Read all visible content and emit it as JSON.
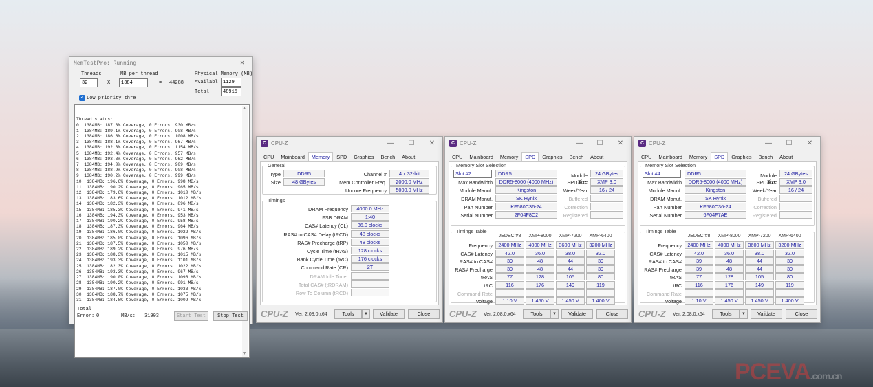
{
  "memtest": {
    "title": "MemTestPro: Running",
    "threads_label": "Threads",
    "threads": "32",
    "mb_label": "MB per thread",
    "mb": "1384",
    "x": "X",
    "eq": "=",
    "total_mb": "44288",
    "phys_label": "Physical Memory (MB)",
    "avail_label": "Availabl",
    "avail": "1129",
    "total_label": "Total",
    "total": "48915",
    "lowprio": "Low priority thre",
    "log": [
      "Thread status:",
      "0: 1384MB: 187.3% Coverage, 0 Errors. 930 MB/s",
      "1: 1384MB: 189.1% Coverage, 0 Errors. 908 MB/s",
      "2: 1384MB: 186.8% Coverage, 0 Errors. 1008 MB/s",
      "3: 1384MB: 188.1% Coverage, 0 Errors. 967 MB/s",
      "4: 1384MB: 192.3% Coverage, 0 Errors. 1154 MB/s",
      "5: 1384MB: 192.4% Coverage, 0 Errors. 957 MB/s",
      "6: 1384MB: 193.3% Coverage, 0 Errors. 962 MB/s",
      "7: 1384MB: 194.0% Coverage, 0 Errors. 909 MB/s",
      "8: 1384MB: 188.9% Coverage, 0 Errors. 908 MB/s",
      "9: 1384MB: 190.2% Coverage, 0 Errors. 999 MB/s",
      "10: 1384MB: 196.6% Coverage, 0 Errors. 998 MB/s",
      "11: 1384MB: 190.2% Coverage, 0 Errors. 965 MB/s",
      "12: 1384MB: 179.6% Coverage, 0 Errors. 1010 MB/s",
      "13: 1384MB: 183.6% Coverage, 0 Errors. 1012 MB/s",
      "14: 1384MB: 182.3% Coverage, 0 Errors. 896 MB/s",
      "15: 1384MB: 185.3% Coverage, 0 Errors. 941 MB/s",
      "16: 1384MB: 194.3% Coverage, 0 Errors. 953 MB/s",
      "17: 1384MB: 190.2% Coverage, 0 Errors. 958 MB/s",
      "18: 1384MB: 187.3% Coverage, 0 Errors. 964 MB/s",
      "19: 1384MB: 186.0% Coverage, 0 Errors. 1022 MB/s",
      "20: 1384MB: 185.0% Coverage, 0 Errors. 1096 MB/s",
      "21: 1384MB: 187.5% Coverage, 0 Errors. 1050 MB/s",
      "22: 1384MB: 189.2% Coverage, 0 Errors. 976 MB/s",
      "23: 1384MB: 188.3% Coverage, 0 Errors. 1015 MB/s",
      "24: 1384MB: 193.3% Coverage, 0 Errors. 1101 MB/s",
      "25: 1384MB: 182.3% Coverage, 0 Errors. 1022 MB/s",
      "26: 1384MB: 193.3% Coverage, 0 Errors. 967 MB/s",
      "27: 1384MB: 190.0% Coverage, 0 Errors. 1098 MB/s",
      "28: 1384MB: 190.2% Coverage, 0 Errors. 991 MB/s",
      "29: 1384MB: 187.0% Coverage, 0 Errors. 1033 MB/s",
      "30: 1384MB: 188.7% Coverage, 0 Errors. 1075 MB/s",
      "31: 1384MB: 184.8% Coverage, 0 Errors. 1009 MB/s"
    ],
    "total_label2": "Total",
    "err_label": "Error:",
    "err": "0",
    "mbs_label": "MB/s:",
    "mbs": "31903",
    "start": "Start Test",
    "stop": "Stop Test"
  },
  "cpuz_common": {
    "title": "CPU-Z",
    "tabs": [
      "CPU",
      "Mainboard",
      "Memory",
      "SPD",
      "Graphics",
      "Bench",
      "About"
    ],
    "brand": "CPU-Z",
    "version": "Ver. 2.08.0.x64",
    "tools": "Tools",
    "validate": "Validate",
    "close": "Close"
  },
  "memory": {
    "general_title": "General",
    "type_label": "Type",
    "type": "DDR5",
    "size_label": "Size",
    "size": "48 GBytes",
    "channel_label": "Channel #",
    "channel": "4 x 32-bit",
    "mcf_label": "Mem Controller Freq.",
    "mcf": "2000.0 MHz",
    "uncore_label": "Uncore Frequency",
    "uncore": "5000.0 MHz",
    "timings_title": "Timings",
    "rows": [
      {
        "label": "DRAM Frequency",
        "value": "4000.0 MHz",
        "dim": false
      },
      {
        "label": "FSB:DRAM",
        "value": "1:40",
        "dim": false
      },
      {
        "label": "CAS# Latency (CL)",
        "value": "36.0 clocks",
        "dim": false
      },
      {
        "label": "RAS# to CAS# Delay (tRCD)",
        "value": "48 clocks",
        "dim": false
      },
      {
        "label": "RAS# Precharge (tRP)",
        "value": "48 clocks",
        "dim": false
      },
      {
        "label": "Cycle Time (tRAS)",
        "value": "128 clocks",
        "dim": false
      },
      {
        "label": "Bank Cycle Time (tRC)",
        "value": "176 clocks",
        "dim": false
      },
      {
        "label": "Command Rate (CR)",
        "value": "2T",
        "dim": false
      },
      {
        "label": "DRAM Idle Timer",
        "value": "",
        "dim": true
      },
      {
        "label": "Total CAS# (tRDRAM)",
        "value": "",
        "dim": true
      },
      {
        "label": "Row To Column (tRCD)",
        "value": "",
        "dim": true
      }
    ]
  },
  "spd_common": {
    "slot_title": "Memory Slot Selection",
    "module_size_label": "Module Size",
    "max_bw_label": "Max Bandwidth",
    "spd_ext_label": "SPD Ext.",
    "manuf_label": "Module Manuf.",
    "week_label": "Week/Year",
    "dram_manuf_label": "DRAM Manuf.",
    "buffered_label": "Buffered",
    "part_label": "Part Number",
    "correction_label": "Correction",
    "serial_label": "Serial Number",
    "registered_label": "Registered",
    "timings_title": "Timings Table",
    "headers": [
      "JEDEC #8",
      "XMP-8000",
      "XMP-7200",
      "XMP-6400"
    ],
    "row_labels": [
      "Frequency",
      "CAS# Latency",
      "RAS# to CAS#",
      "RAS# Precharge",
      "tRAS",
      "tRC",
      "Command Rate",
      "Voltage"
    ]
  },
  "spd1": {
    "slot": "Slot #2",
    "type": "DDR5",
    "module_size": "24 GBytes",
    "max_bw": "DDR5-8000 (4000 MHz)",
    "spd_ext": "XMP 3.0",
    "manuf": "Kingston",
    "week": "16 / 24",
    "dram_manuf": "SK Hynix",
    "part": "KF580C36-24",
    "serial": "2F04F8C2",
    "table": [
      [
        "2400 MHz",
        "4000 MHz",
        "3600 MHz",
        "3200 MHz"
      ],
      [
        "42.0",
        "36.0",
        "38.0",
        "32.0"
      ],
      [
        "39",
        "48",
        "44",
        "39"
      ],
      [
        "39",
        "48",
        "44",
        "39"
      ],
      [
        "77",
        "128",
        "105",
        "80"
      ],
      [
        "116",
        "176",
        "149",
        "119"
      ],
      [
        "",
        "",
        "",
        ""
      ],
      [
        "1.10 V",
        "1.450 V",
        "1.450 V",
        "1.400 V"
      ]
    ]
  },
  "spd2": {
    "slot": "Slot #4",
    "type": "DDR5",
    "module_size": "24 GBytes",
    "max_bw": "DDR5-8000 (4000 MHz)",
    "spd_ext": "XMP 3.0",
    "manuf": "Kingston",
    "week": "16 / 24",
    "dram_manuf": "SK Hynix",
    "part": "KF580C36-24",
    "serial": "6F04F7AE",
    "table": [
      [
        "2400 MHz",
        "4000 MHz",
        "3600 MHz",
        "3200 MHz"
      ],
      [
        "42.0",
        "36.0",
        "38.0",
        "32.0"
      ],
      [
        "39",
        "48",
        "44",
        "39"
      ],
      [
        "39",
        "48",
        "44",
        "39"
      ],
      [
        "77",
        "128",
        "105",
        "80"
      ],
      [
        "116",
        "176",
        "149",
        "119"
      ],
      [
        "",
        "",
        "",
        ""
      ],
      [
        "1.10 V",
        "1.450 V",
        "1.450 V",
        "1.400 V"
      ]
    ]
  },
  "watermark": {
    "main": "PCEVA",
    "sub": ".com.cn"
  }
}
